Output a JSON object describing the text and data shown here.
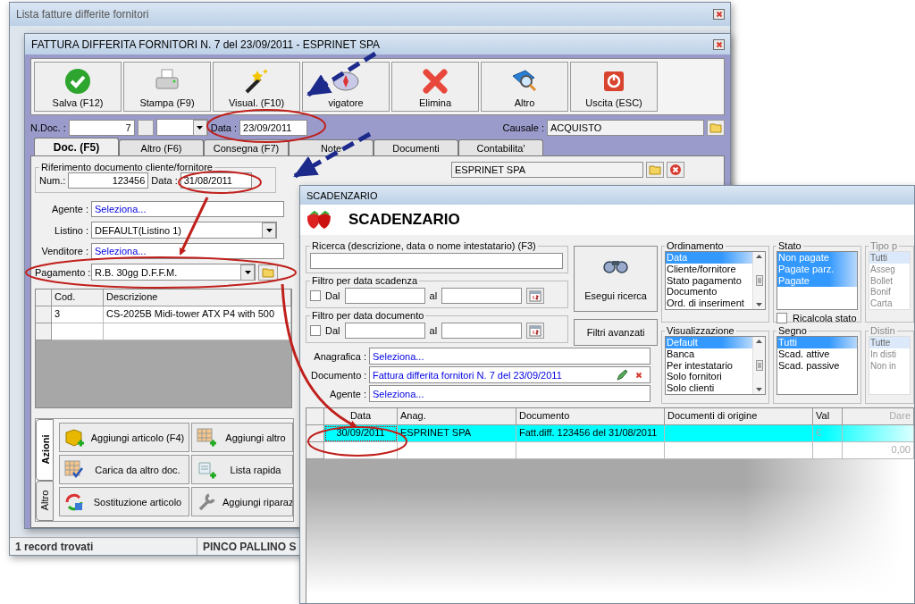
{
  "back_window": {
    "title": "Lista fatture differite fornitori",
    "status_bar": [
      "1 record trovati",
      "PINCO PALLINO S"
    ]
  },
  "invoice_window": {
    "title": "FATTURA DIFFERITA FORNITORI N. 7  del 23/09/2011 - ESPRINET SPA",
    "toolbar": [
      {
        "kind": "save",
        "label": "Salva (F12)"
      },
      {
        "kind": "print",
        "label": "Stampa (F9)"
      },
      {
        "kind": "wand",
        "label": "Visual. (F10)"
      },
      {
        "kind": "compass",
        "label": "vigatore"
      },
      {
        "kind": "delete",
        "label": "Elimina"
      },
      {
        "kind": "book",
        "label": "Altro"
      },
      {
        "kind": "exit",
        "label": "Uscita (ESC)"
      }
    ],
    "ndoc": {
      "label": "N.Doc. :",
      "value": "7"
    },
    "date": {
      "label": "Data :",
      "value": "23/09/2011"
    },
    "causale": {
      "label": "Causale :",
      "value": "ACQUISTO"
    },
    "tabs": [
      {
        "label": "Doc. (F5)",
        "selected": true
      },
      {
        "label": "Altro (F6)",
        "selected": false
      },
      {
        "label": "Consegna (F7)",
        "selected": false
      },
      {
        "label": "Note",
        "selected": false
      },
      {
        "label": "Documenti",
        "selected": false
      },
      {
        "label": "Contabilita'",
        "selected": false
      }
    ],
    "reference": {
      "title": "Riferimento documento cliente/fornitore",
      "num_label": "Num.:",
      "num": "123456",
      "date_label": "Data :",
      "date": "31/08/2011"
    },
    "supplier": "ESPRINET SPA",
    "fields": [
      {
        "kind": "link",
        "label": "Agente :",
        "value": "Seleziona..."
      },
      {
        "kind": "dropdown",
        "label": "Listino :",
        "value": "DEFAULT(Listino 1)"
      },
      {
        "kind": "link",
        "label": "Venditore :",
        "value": "Seleziona..."
      },
      {
        "kind": "dropdown_folder",
        "label": "Pagamento :",
        "value": "R.B. 30gg D.F.F.M."
      }
    ],
    "lines": {
      "columns": [
        "Cod.",
        "Descrizione"
      ],
      "rows": [
        [
          "3",
          "CS-2025B Midi-tower ATX P4 with 500"
        ]
      ]
    },
    "side_tabs": [
      {
        "label": "Azioni",
        "selected": true
      },
      {
        "label": "Altro",
        "selected": false
      }
    ],
    "actions": [
      {
        "kind": "box_add",
        "label": "Aggiungi articolo (F4)"
      },
      {
        "kind": "grid_add",
        "label": "Aggiungi altro"
      },
      {
        "kind": "grid_check",
        "label": "Carica da altro doc."
      },
      {
        "kind": "scroll_add",
        "label": "Lista rapida"
      },
      {
        "kind": "swap",
        "label": "Sostituzione articolo"
      },
      {
        "kind": "wrench",
        "label": "Aggiungi riparaz"
      }
    ]
  },
  "scadenzario": {
    "title": "SCADENZARIO",
    "heading": "SCADENZARIO",
    "search": {
      "title": "Ricerca (descrizione, data o nome intestatario) (F3)"
    },
    "date_filters": [
      {
        "title": "Filtro per data scadenza",
        "checked": false,
        "from_label": "Dal",
        "to_label": "al"
      },
      {
        "title": "Filtro per data documento",
        "checked": false,
        "from_label": "Dal",
        "to_label": "al"
      }
    ],
    "buttons": [
      {
        "kind": "search",
        "label": "Esegui ricerca"
      },
      {
        "kind": "plain",
        "label": "Filtri avanzati"
      }
    ],
    "lists": [
      {
        "title": "Ordinamento",
        "faded": false,
        "scroll": true,
        "items": [
          {
            "label": "Data",
            "selected": true
          },
          {
            "label": "Cliente/fornitore",
            "selected": false
          },
          {
            "label": "Stato pagamento",
            "selected": false
          },
          {
            "label": "Documento",
            "selected": false
          },
          {
            "label": "Ord. di inseriment",
            "selected": false
          }
        ]
      },
      {
        "title": "Stato",
        "faded": false,
        "scroll": false,
        "items": [
          {
            "label": "Non pagate",
            "selected": true
          },
          {
            "label": "Pagate parz.",
            "selected": true
          },
          {
            "label": "Pagate",
            "selected": true
          }
        ],
        "recalc": {
          "label": "Ricalcola stato",
          "checked": false
        }
      },
      {
        "title": "Tipo p",
        "faded": true,
        "scroll": false,
        "items": [
          {
            "label": "Tutti",
            "selected": true
          },
          {
            "label": "Asseg",
            "selected": false
          },
          {
            "label": "Bollet",
            "selected": false
          },
          {
            "label": "Bonif",
            "selected": false
          },
          {
            "label": "Carta",
            "selected": false
          }
        ]
      },
      {
        "title": "Visualizzazione",
        "faded": false,
        "scroll": true,
        "items": [
          {
            "label": "Default",
            "selected": true
          },
          {
            "label": "Banca",
            "selected": false
          },
          {
            "label": "Per intestatario",
            "selected": false
          },
          {
            "label": "Solo fornitori",
            "selected": false
          },
          {
            "label": "Solo clienti",
            "selected": false
          }
        ]
      },
      {
        "title": "Segno",
        "faded": false,
        "scroll": false,
        "items": [
          {
            "label": "Tutti",
            "selected": true
          },
          {
            "label": "Scad. attive",
            "selected": false
          },
          {
            "label": "Scad. passive",
            "selected": false
          }
        ]
      },
      {
        "title": "Distin",
        "faded": true,
        "scroll": false,
        "items": [
          {
            "label": "Tutte",
            "selected": true
          },
          {
            "label": "In disti",
            "selected": false
          },
          {
            "label": "Non in",
            "selected": false
          }
        ]
      }
    ],
    "fields": [
      {
        "label": "Anagrafica :",
        "value": "Seleziona...",
        "tools": false
      },
      {
        "label": "Documento :",
        "value": "Fattura differita fornitori N. 7 del 23/09/2011",
        "tools": true
      },
      {
        "label": "Agente :",
        "value": "Seleziona...",
        "tools": false
      }
    ],
    "grid": {
      "columns": [
        "Data",
        "Anag.",
        "Documento",
        "Documenti di origine",
        "Val",
        "Dare"
      ],
      "rows": [
        {
          "selected": true,
          "cells": [
            "30/09/2011",
            "ESPRINET SPA",
            "Fatt.diff. 123456 del 31/08/2011",
            null,
            "€",
            null
          ]
        },
        {
          "selected": false,
          "cells": [
            null,
            null,
            null,
            null,
            null,
            "0,00"
          ]
        }
      ]
    }
  }
}
